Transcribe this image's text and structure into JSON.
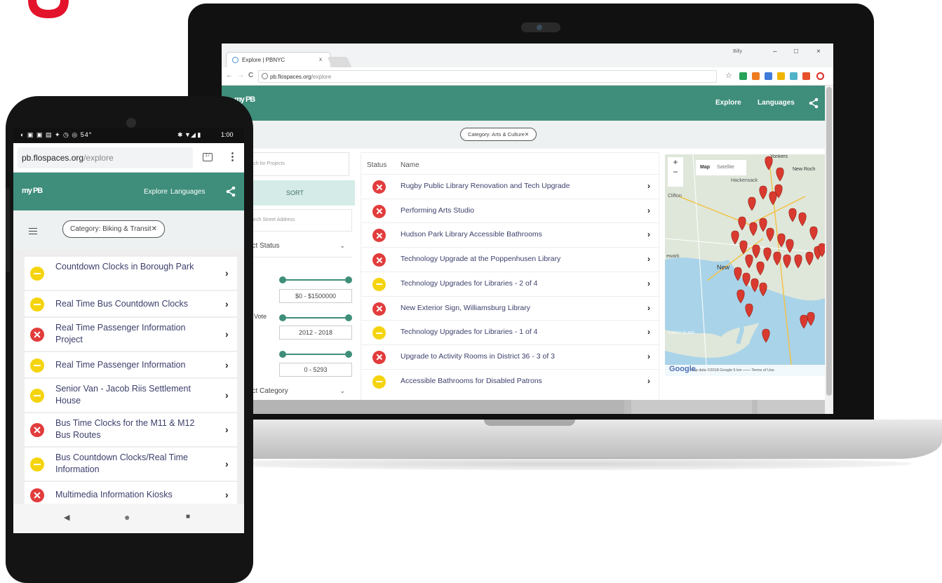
{
  "laptop": {
    "browser": {
      "tab_title": "Explore | PBNYC",
      "tab_close": "x",
      "window_user": "Billy",
      "window_controls": [
        "–",
        "□",
        "×"
      ],
      "nav_back": "←",
      "nav_forward": "→",
      "nav_reload": "C",
      "url_host": "pb.flospaces.org",
      "url_path": "/explore",
      "star": "☆"
    },
    "app": {
      "logo": "my PB",
      "nav": [
        "Explore",
        "Languages"
      ],
      "chip": "Category: Arts & Culture✕"
    },
    "left_panel": {
      "search_placeholder": "arch for Projects",
      "tabs": [
        "R",
        "SORT"
      ],
      "address_placeholder": "earch Street Address",
      "status_select": "ect Status",
      "range_cost": "$0 - $1500000",
      "vote_label": "Vote",
      "range_vote": "2012 - 2018",
      "range_votes": "0 - 5293",
      "category_select": "ect Category"
    },
    "table": {
      "headers": [
        "Status",
        "Name"
      ],
      "rows": [
        {
          "status": "red",
          "name": "Rugby Public Library Renovation and Tech Upgrade"
        },
        {
          "status": "red",
          "name": "Performing Arts Studio"
        },
        {
          "status": "red",
          "name": "Hudson Park Library Accessible Bathrooms"
        },
        {
          "status": "red",
          "name": "Technology Upgrade at the Poppenhusen Library"
        },
        {
          "status": "yellow",
          "name": "Technology Upgrades for Libraries - 2 of 4"
        },
        {
          "status": "red",
          "name": "New Exterior Sign, Williamsburg Library"
        },
        {
          "status": "yellow",
          "name": "Technology Upgrades for Libraries - 1 of 4"
        },
        {
          "status": "red",
          "name": "Upgrade to Activity Rooms in District 36 - 3 of 3"
        },
        {
          "status": "yellow",
          "name": "Accessible Bathrooms for Disabled Patrons"
        }
      ],
      "arrow": "›"
    },
    "map": {
      "toggle": [
        "Map",
        "Satellite"
      ],
      "zoom": [
        "+",
        "−"
      ],
      "labels": [
        "Yonkers",
        "New Roch",
        "Hackensack",
        "Clifton",
        "ewark",
        "New",
        "STATEN ISLAND"
      ],
      "google": "Google",
      "attribution": "Map data ©2018 Google   5 km ⎯⎯⎯⎯   Terms of Use"
    }
  },
  "phone": {
    "status_time": "1:00",
    "status_left": "◐ ▣ ▣ ▤ ✦ ◷ ◎ 54°",
    "status_right": "✱ ▼◢ ▮",
    "url_host": "pb.flospaces.org",
    "url_path": "/explore",
    "tabs_count": "17",
    "menu": "⋮",
    "app_logo": "my PB",
    "nav": [
      "Explore",
      "Languages"
    ],
    "chip": "Category: Biking & Transit✕",
    "items": [
      {
        "status": "yellow",
        "name": "Countdown Clocks in Borough Park"
      },
      {
        "status": "yellow",
        "name": "Real Time Bus Countdown Clocks"
      },
      {
        "status": "red",
        "name": "Real Time Passenger Information Project"
      },
      {
        "status": "yellow",
        "name": "Real Time Passenger Information"
      },
      {
        "status": "yellow",
        "name": "Senior Van - Jacob Riis Settlement House"
      },
      {
        "status": "red",
        "name": "Bus Time Clocks for the M11 & M12 Bus Routes"
      },
      {
        "status": "yellow",
        "name": "Bus Countdown Clocks/Real Time Information"
      },
      {
        "status": "red",
        "name": "Multimedia Information Kiosks"
      }
    ],
    "arrow": "›",
    "navbar": [
      "◀",
      "●",
      "■"
    ]
  },
  "colors": {
    "brand_green": "#3e8e7b",
    "status_red": "#e23c3c",
    "status_yellow": "#f5d40f",
    "link_text": "#3b3f6b",
    "logo_red": "#e3132b",
    "map_pin": "#d93a2f"
  }
}
